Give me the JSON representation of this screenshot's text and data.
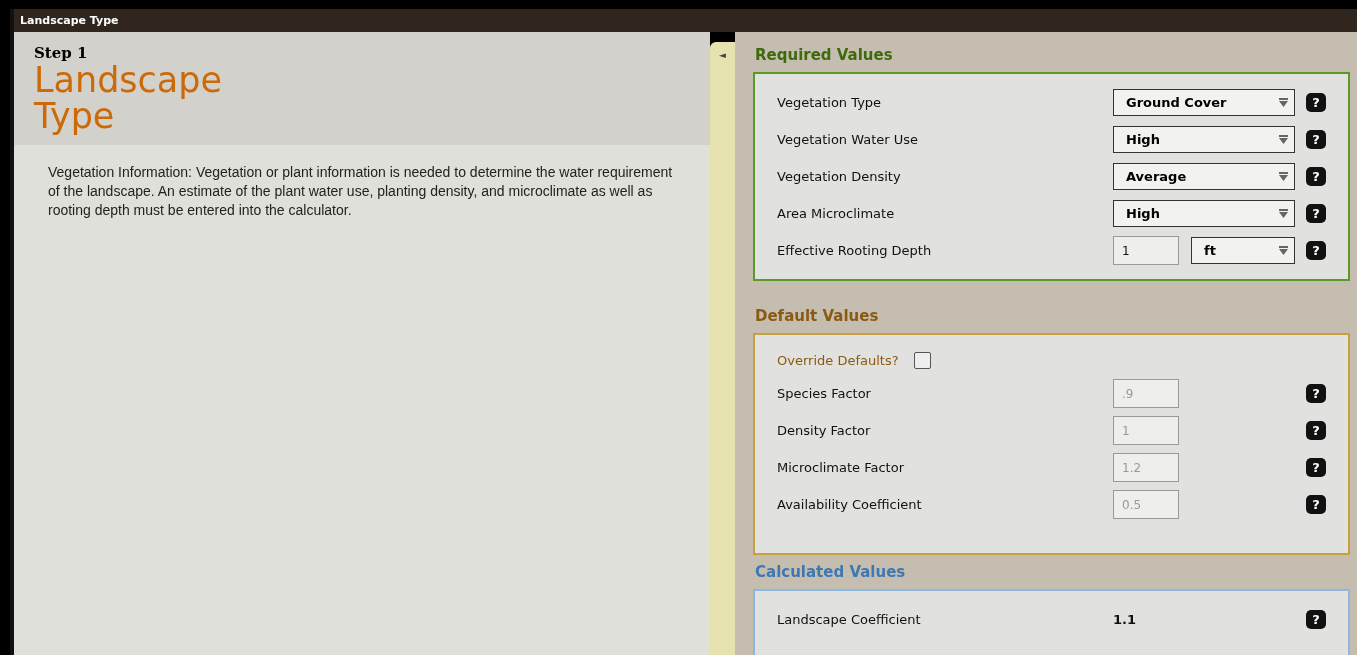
{
  "window": {
    "title": "Landscape Type"
  },
  "step": {
    "label": "Step 1",
    "title": "Landscape Type",
    "description": "Vegetation Information: Vegetation or plant information is needed to determine the water requirement of the landscape. An estimate of the plant water use, planting density, and microclimate as well as rooting depth must be entered into the calculator."
  },
  "splitter": {
    "arrow": "◄"
  },
  "required_values": {
    "heading": "Required Values",
    "rows": [
      {
        "kind": "select",
        "label": "Vegetation Type",
        "value": "Ground Cover",
        "help": "?"
      },
      {
        "kind": "select",
        "label": "Vegetation Water Use",
        "value": "High",
        "help": "?"
      },
      {
        "kind": "select",
        "label": "Vegetation Density",
        "value": "Average",
        "help": "?"
      },
      {
        "kind": "select",
        "label": "Area Microclimate",
        "value": "High",
        "help": "?"
      },
      {
        "kind": "number_unit",
        "label": "Effective Rooting Depth",
        "value": "1",
        "unit": "ft",
        "help": "?"
      }
    ]
  },
  "default_values": {
    "heading": "Default Values",
    "override": {
      "label": "Override Defaults?",
      "checked": false
    },
    "rows": [
      {
        "label": "Species Factor",
        "value": ".9",
        "disabled": true,
        "help": "?"
      },
      {
        "label": "Density Factor",
        "value": "1",
        "disabled": true,
        "help": "?"
      },
      {
        "label": "Microclimate Factor",
        "value": "1.2",
        "disabled": true,
        "help": "?"
      },
      {
        "label": "Availability Coefficient",
        "value": "0.5",
        "disabled": true,
        "help": "?"
      }
    ]
  },
  "calculated_values": {
    "heading": "Calculated Values",
    "rows": [
      {
        "label": "Landscape Coefficient",
        "value": "1.1",
        "help": "?"
      }
    ]
  }
}
